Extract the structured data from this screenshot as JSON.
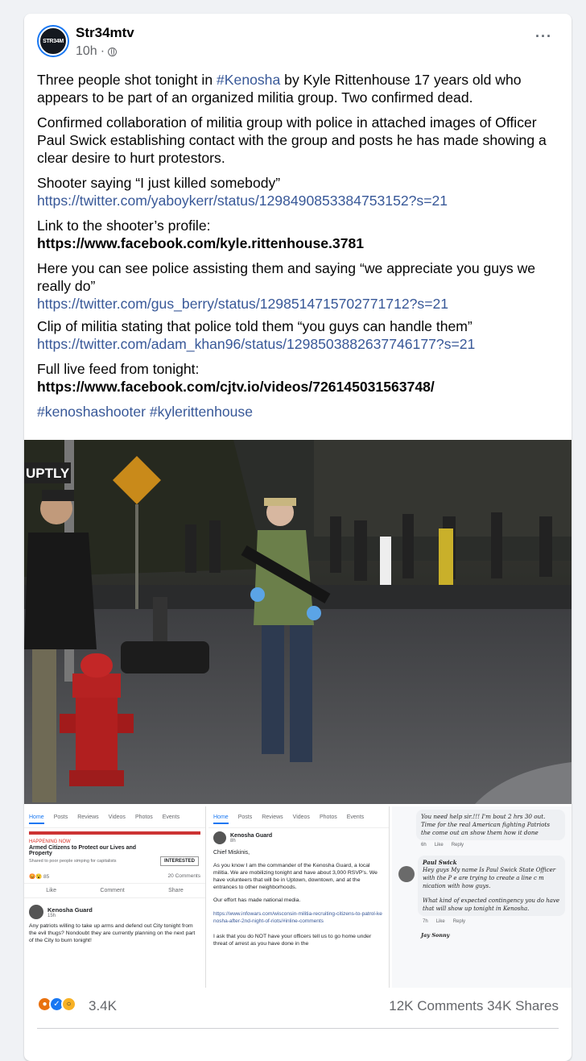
{
  "post": {
    "author": "Str34mtv",
    "avatar_text": "STR34M",
    "time": "10h",
    "separator": "·",
    "more": "···",
    "p1_pre": "Three people shot tonight in ",
    "p1_tag": "#Kenosha",
    "p1_post": " by Kyle Rittenhouse 17 years old who appears to be part of an organized militia group. Two confirmed dead.",
    "p2": "Confirmed collaboration of militia group with police in attached images of Officer Paul Swick establishing contact with the group and posts he has made showing a clear desire to hurt protestors.",
    "p3": "Shooter saying “I just killed somebody”",
    "p3_link": "https://twitter.com/yaboykerr/status/1298490853384753152?s=21",
    "p4": "Link to the shooter’s profile:",
    "p4_link": "https://www.facebook.com/kyle.rittenhouse.3781",
    "p5": "Here you can see police assisting them and saying “we appreciate you guys we really do”",
    "p5_link": "https://twitter.com/gus_berry/status/1298514715702771712?s=21",
    "p6": "Clip of militia stating that police told them “you guys can handle them”",
    "p6_link": "https://twitter.com/adam_khan96/status/1298503882637746177?s=21",
    "p7": "Full live feed from tonight:",
    "p7_link": "https://www.facebook.com/cjtv.io/videos/726145031563748/",
    "hashtags_1": "#kenoshashooter",
    "hashtags_2": "#kylerittenhouse"
  },
  "photo": {
    "watermark": "UPTLY"
  },
  "collage": {
    "pane1": {
      "tabs": [
        "Home",
        "Posts",
        "Reviews",
        "Videos",
        "Photos",
        "Events"
      ],
      "happening": "HAPPENING NOW",
      "event_title": "Armed Citizens to Protect our Lives and Property",
      "event_shared": "Shared to poor people simping for capitalists",
      "interested": "INTERESTED",
      "likes": "85",
      "comments": "20 Comments",
      "like_btn": "Like",
      "comment_btn": "Comment",
      "share_btn": "Share",
      "poster": "Kenosha Guard",
      "poster_time": "15h",
      "post_text": "Any patriots willing to take up arms and defend out City tonight from the evil thugs? Nondoubt they are currently planning on the next part of the City to burn tonight!"
    },
    "pane2": {
      "tabs": [
        "Home",
        "Posts",
        "Reviews",
        "Videos",
        "Photos",
        "Events"
      ],
      "poster": "Kenosha Guard",
      "poster_time": "8h",
      "salutation": "Chief Miskinis,",
      "para1": "As you know I am the commander of the Kenosha Guard, a local militia. We are mobilizing tonight and have about 3,000 RSVP's. We have volunteers that will be in Uptown, downtown, and at the entrances to other neighborhoods.",
      "para2": "Our effort has made national media.",
      "link": "https://www.infowars.com/wisconsin-militia-recruiting-citizens-to-patrol-kenosha-after-2nd-night-of-riots/#inline-comments",
      "para3": "I ask that you do NOT have your officers tell us to go home under threat of arrest as you have done in the"
    },
    "pane3": {
      "c1_text": "You need help sir.!!! I'm bout 2 hrs 30 out. Time for the real American fighting Patriots the come out an show them how it done",
      "c1_time": "6h",
      "like": "Like",
      "reply": "Reply",
      "c2_name": "Paul Swick",
      "c2_text": "Hey guys My name Is Paul Swick State Officer with the  P  e are trying to create a line  c  m  nication with how guys.",
      "c2_text2": "What kind of expected contingency you do have that will show up tonight in Kenosha.",
      "c2_time": "7h",
      "c3_name": "Jay Sonny"
    }
  },
  "footer": {
    "reaction_count": "3.4K",
    "comments": "12K Comments",
    "shares": "34K Shares"
  },
  "colors": {
    "link": "#385898",
    "facebook_blue": "#1877f2",
    "secondary_text": "#65676b"
  }
}
